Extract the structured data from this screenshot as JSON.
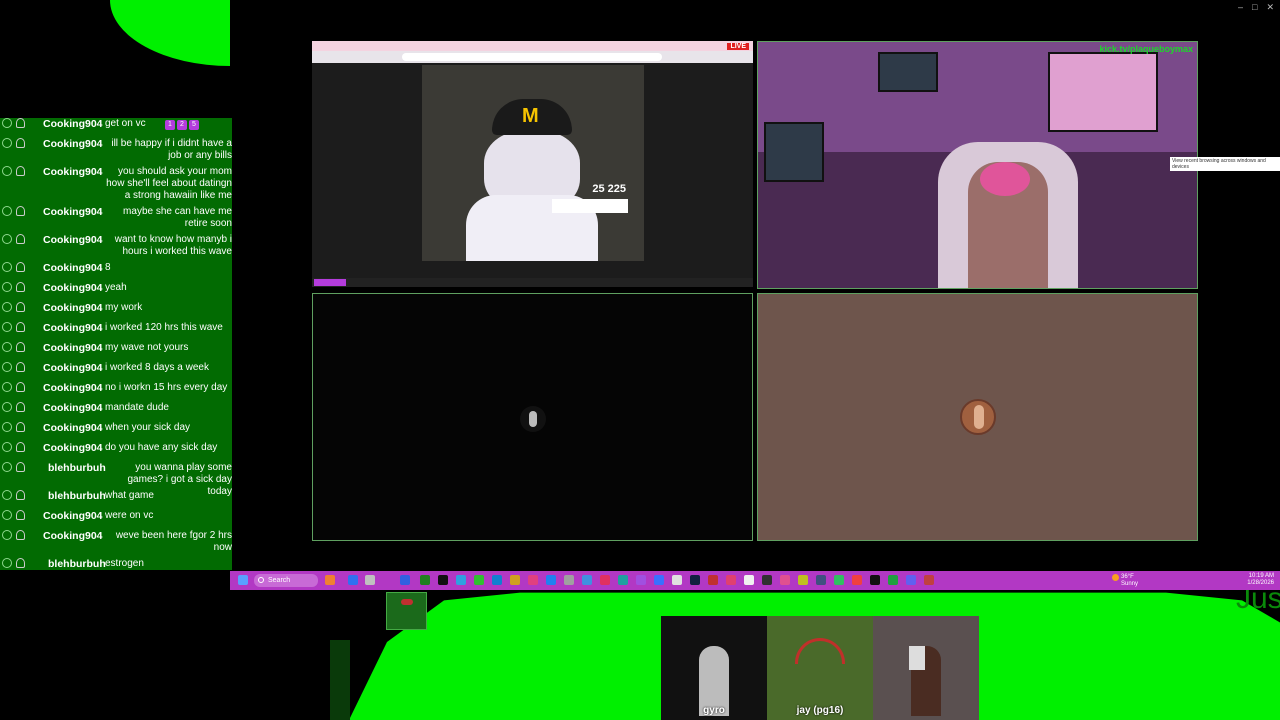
{
  "window_controls": [
    "–",
    "□",
    "✕"
  ],
  "chat": {
    "messages": [
      {
        "user": "Cooking904",
        "text": "get on vc",
        "badges": [
          "1",
          "2",
          "5"
        ],
        "inline": true
      },
      {
        "user": "Cooking904",
        "text": "ill be happy if i didnt have a job or any bills",
        "inline": false
      },
      {
        "user": "Cooking904",
        "text": "you should ask your mom how she'll feel about datingn a strong hawaiin like me",
        "inline": false
      },
      {
        "user": "Cooking904",
        "text": "maybe she can have me retire soon",
        "inline": false
      },
      {
        "user": "Cooking904",
        "text": "want to know how manyb i hours i worked this wave",
        "inline": false
      },
      {
        "user": "Cooking904",
        "text": "8",
        "inline": true
      },
      {
        "user": "Cooking904",
        "text": "yeah",
        "inline": true
      },
      {
        "user": "Cooking904",
        "text": "my work",
        "inline": true
      },
      {
        "user": "Cooking904",
        "text": "i worked 120 hrs this wave",
        "inline": true
      },
      {
        "user": "Cooking904",
        "text": "my wave not yours",
        "inline": true
      },
      {
        "user": "Cooking904",
        "text": "i worked 8 days a week",
        "inline": true
      },
      {
        "user": "Cooking904",
        "text": "no i workn 15 hrs every day",
        "inline": true
      },
      {
        "user": "Cooking904",
        "text": "mandate dude",
        "inline": true
      },
      {
        "user": "Cooking904",
        "text": "when your sick day",
        "inline": true
      },
      {
        "user": "Cooking904",
        "text": "do you have any sick day",
        "inline": true
      },
      {
        "user": "blehburbuh",
        "text": "you wanna play some games? i got a sick day today",
        "inline": false
      },
      {
        "user": "blehburbuh",
        "text": "what game",
        "inline": true
      },
      {
        "user": "Cooking904",
        "text": "were on vc",
        "inline": true
      },
      {
        "user": "Cooking904",
        "text": "weve been here fgor 2 hrs now",
        "inline": false
      },
      {
        "user": "blehburbuh",
        "text": "estrogen",
        "inline": true
      }
    ]
  },
  "panels": {
    "stream1": {
      "live_label": "LIVE",
      "hud_value": "25  225"
    },
    "stream2": {
      "overlay": "kick.tv/plaqueboymax"
    },
    "tooltip": "View recent browsing across windows and devices"
  },
  "taskbar": {
    "search_placeholder": "Search",
    "weather_temp": "36°F",
    "weather_desc": "Sunny",
    "time": "10:19 AM",
    "date": "1/28/2026"
  },
  "cams": [
    {
      "name": "gyro"
    },
    {
      "name": "jay (pg16)"
    },
    {
      "name": ""
    }
  ],
  "overlay_text": "Jus"
}
